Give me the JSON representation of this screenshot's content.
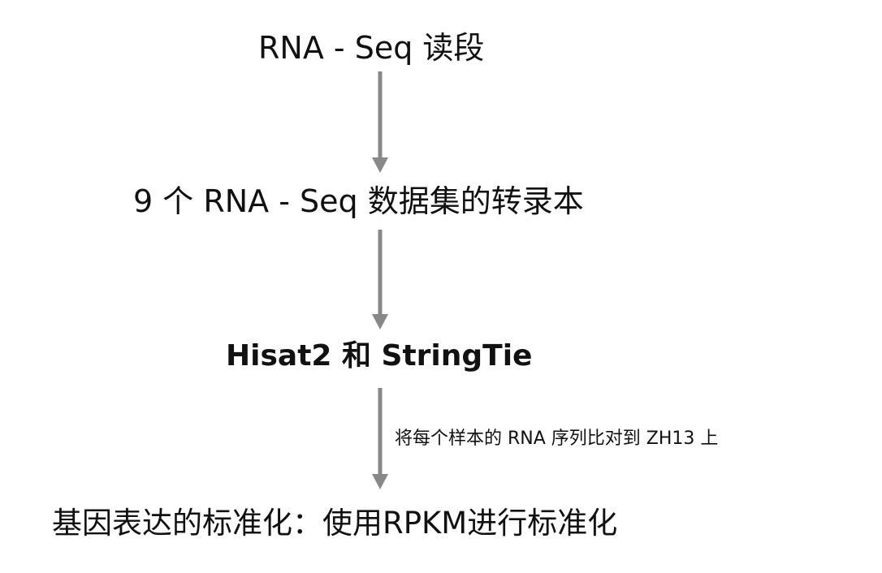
{
  "nodes": [
    {
      "id": "n1",
      "label": "RNA - Seq 读段"
    },
    {
      "id": "n2",
      "label": "9 个 RNA - Seq 数据集的转录本"
    },
    {
      "id": "n3",
      "label": "Hisat2 和 StringTie"
    },
    {
      "id": "n4",
      "label": "基因表达的标准化：使用RPKM进行标准化"
    }
  ],
  "edges": [
    {
      "from": "n1",
      "to": "n2",
      "label": ""
    },
    {
      "from": "n2",
      "to": "n3",
      "label": ""
    },
    {
      "from": "n3",
      "to": "n4",
      "label": "将每个样本的 RNA 序列比对到 ZH13 上"
    }
  ],
  "colors": {
    "arrow": "#888888",
    "text": "#111111"
  }
}
